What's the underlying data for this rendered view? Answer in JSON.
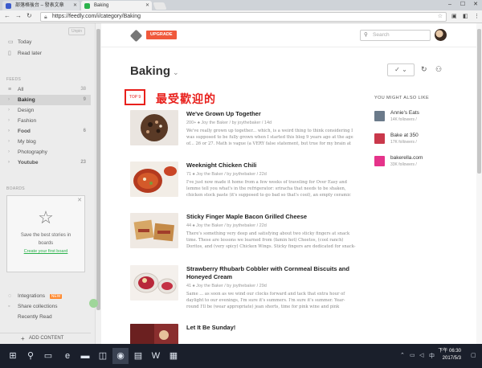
{
  "browser": {
    "tabs": [
      {
        "label": "部落格後台 – 發表文章",
        "color": "#3b5bcc"
      },
      {
        "label": "Baking",
        "color": "#2bb24c"
      }
    ],
    "url": "https://feedly.com/i/category/Baking"
  },
  "sidebar": {
    "unpin": "Unpin",
    "top_items": [
      {
        "label": "Today",
        "icon": "today-icon"
      },
      {
        "label": "Read later",
        "icon": "bookmark-icon"
      }
    ],
    "feeds_heading": "FEEDS",
    "feeds": [
      {
        "label": "All",
        "count": "38",
        "active": false
      },
      {
        "label": "Baking",
        "count": "9",
        "active": true
      },
      {
        "label": "Design",
        "count": "",
        "active": false
      },
      {
        "label": "Fashion",
        "count": "",
        "active": false
      },
      {
        "label": "Food",
        "count": "6",
        "active": false
      },
      {
        "label": "My blog",
        "count": "",
        "active": false
      },
      {
        "label": "Photography",
        "count": "",
        "active": false
      },
      {
        "label": "Youtube",
        "count": "23",
        "active": false
      }
    ],
    "boards_heading": "BOARDS",
    "board_promo": {
      "text": "Save the best stories in boards",
      "link": "Create your first board"
    },
    "bottom_items": [
      {
        "label": "Integrations",
        "badge": "NEW"
      },
      {
        "label": "Share collections",
        "badge": ""
      },
      {
        "label": "Recently Read",
        "badge": ""
      }
    ],
    "add_content": "ADD CONTENT"
  },
  "header": {
    "upgrade": "UPGRADE",
    "search_placeholder": "Search"
  },
  "page": {
    "title": "Baking",
    "top_label": "TOP 9",
    "annotation": "最受歡迎的"
  },
  "articles": [
    {
      "title": "We've Grown Up Together",
      "meta": "200+ ♠  Joy the Baker / by joythebaker / 14d",
      "summary": "We've really grown up together... which, is a weird thing to think considering I was supposed to be fully grown when I started this blog 9 years ago at the age of... 26 or 27. Math is vague (a VERY false statement, but true for my brain at the",
      "image": "cookies"
    },
    {
      "title": "Weeknight Chicken Chili",
      "meta": "71 ♠  Joy the Baker / by joythebaker / 22d",
      "summary": "I've just now made it home from a few weeks of traveling for Over Easy and lemme tell you what's in the refrigerator: sriracha that needs to be shaken, chicken stock paste (it's supposed to go bad so that's cool), an empty ceramic",
      "image": "chili"
    },
    {
      "title": "Sticky Finger Maple Bacon Grilled Cheese",
      "meta": "44 ♠  Joy the Baker / by joythebaker / 22d",
      "summary": "There's something very deep and satisfying about two sticky fingers at snack time. These are lessons we learned from (famin hot) Cheetos, (cool ranch) Doritos, and (very spicy) Chicken Wings. Sticky fingers are dedicated for snack-to-mouth",
      "image": "grilledcheese"
    },
    {
      "title": "Strawberry Rhubarb Cobbler with Cornmeal Biscuits and Honeyed Cream",
      "meta": "41 ♠  Joy the Baker / by joythebaker / 29d",
      "summary": "Same ... as soon as we wind our clocks forward and tack that extra hour of daylight to our evenings, I'm sure it's summers. I'm sure it's summer. Year-round I'll be (wear appropriate) jean shorts, time for pink wine and pink sunsets, time for pie",
      "image": "cobbler"
    },
    {
      "title": "Let It Be Sunday!",
      "meta": "",
      "summary": "",
      "image": "sunday"
    }
  ],
  "you_might_also_like": {
    "heading": "YOU MIGHT ALSO LIKE",
    "items": [
      {
        "name": "Annie's Eats",
        "followers": "14K followers /",
        "color": "#6b7a8a"
      },
      {
        "name": "Bake at 350",
        "followers": "17K followers /",
        "color": "#c9384b"
      },
      {
        "name": "bakerella.com",
        "followers": "33K followers /",
        "color": "#e5338a"
      }
    ]
  },
  "taskbar": {
    "time": "下午 06:30",
    "date": "2017/5/3"
  }
}
